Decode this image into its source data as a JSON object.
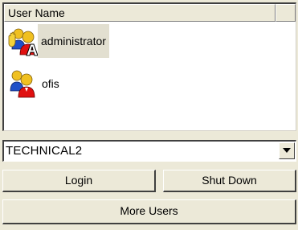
{
  "users_list": {
    "column_header": "User Name",
    "users": [
      {
        "name": "administrator",
        "icon": "admin-user-icon",
        "selected": true
      },
      {
        "name": "ofis",
        "icon": "user-icon",
        "selected": false
      }
    ]
  },
  "domain_select": {
    "value": "TECHNICAL2"
  },
  "buttons": {
    "login": "Login",
    "shutdown": "Shut Down",
    "more_users": "More Users"
  },
  "colors": {
    "face": "#ece9d8",
    "selection": "#e2dfd0",
    "user_red": "#e01010",
    "user_blue": "#2050c8",
    "head_yellow": "#f0c020"
  }
}
